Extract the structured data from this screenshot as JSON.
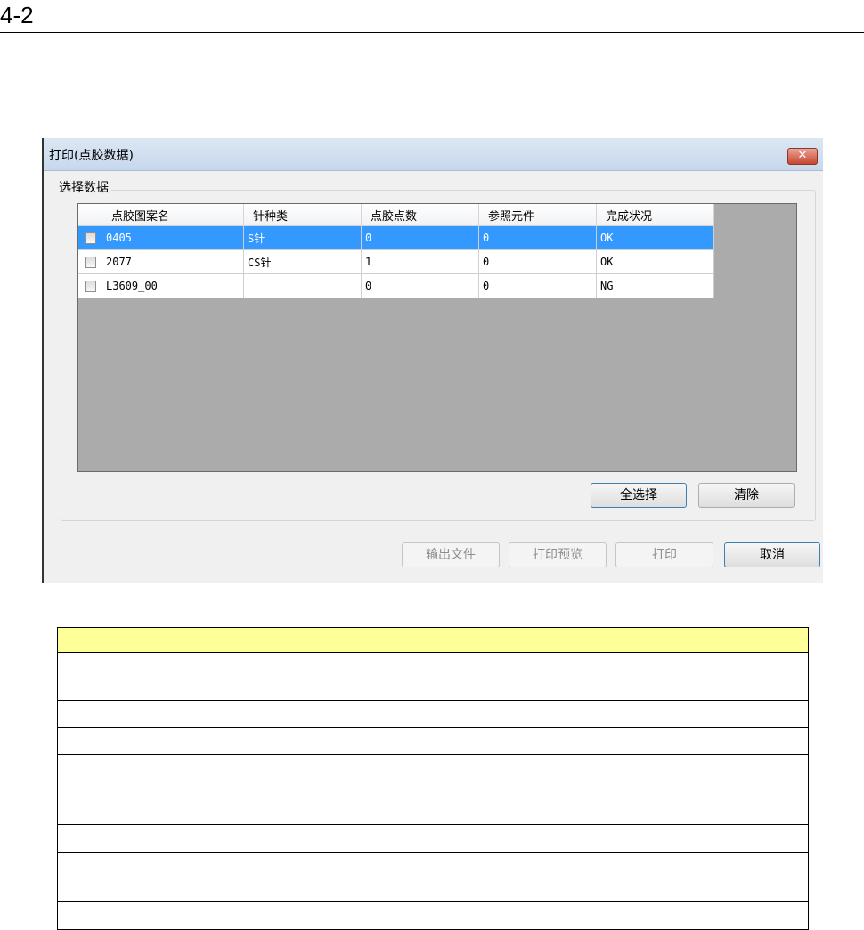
{
  "page": {
    "section_number": "4-2"
  },
  "dialog": {
    "title": "打印(点胶数据)",
    "close_glyph": "✕",
    "group_label": "选择数据",
    "columns": [
      "点胶图案名",
      "针种类",
      "点胶点数",
      "参照元件",
      "完成状况"
    ],
    "rows": [
      {
        "selected": true,
        "checked": false,
        "cells": [
          "0405",
          "S针",
          "0",
          "0",
          "OK"
        ]
      },
      {
        "selected": false,
        "checked": false,
        "cells": [
          "2077",
          "CS针",
          "1",
          "0",
          "OK"
        ]
      },
      {
        "selected": false,
        "checked": false,
        "cells": [
          "L3609_00",
          "",
          "0",
          "0",
          "NG"
        ]
      }
    ],
    "select_all_label": "全选择",
    "clear_label": "清除",
    "export_label": "输出文件",
    "preview_label": "打印预览",
    "print_label": "打印",
    "cancel_label": "取消"
  },
  "description_table": {
    "header_color": "#ffff99",
    "rows": 7
  }
}
